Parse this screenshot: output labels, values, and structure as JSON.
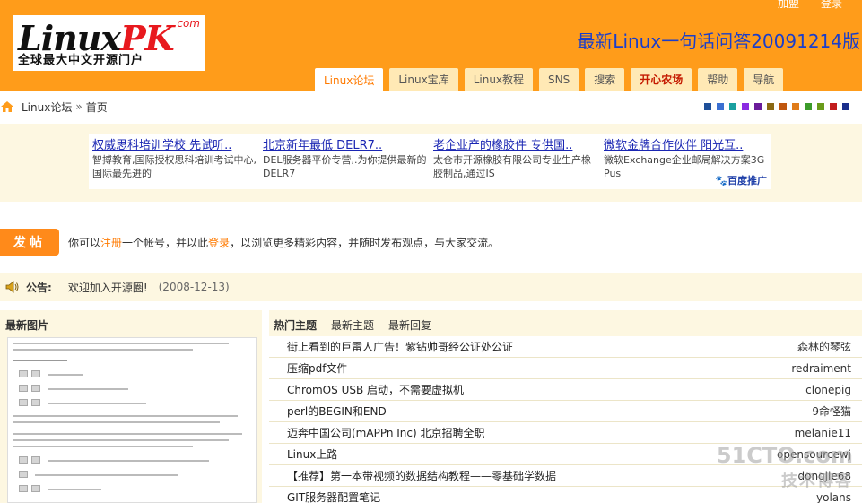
{
  "header": {
    "top_links": [
      "加盟",
      "登录"
    ],
    "logo": {
      "word_a": "Linux",
      "word_b": "PK",
      "com": ".com",
      "slogan": "全球最大中文开源门户"
    },
    "announcement": "最新Linux一句话问答20091214版"
  },
  "nav": [
    "Linux论坛",
    "Linux宝库",
    "Linux教程",
    "SNS",
    "搜索",
    "开心农场",
    "帮助",
    "导航"
  ],
  "breadcrumb": {
    "forum": "Linux论坛",
    "sep": "»",
    "page": "首页"
  },
  "color_swatches": [
    "#1e4f99",
    "#3b6fd1",
    "#1aa0a0",
    "#8a2be2",
    "#6a1b9a",
    "#8b6914",
    "#c0570e",
    "#e07b18",
    "#3c9b2a",
    "#6a9b1a",
    "#c21d1d",
    "#1a2e8c"
  ],
  "ads": [
    {
      "title": "权威思科培训学校 先试听..",
      "desc": "智搏教育,国际授权思科培训考试中心,国际最先进的"
    },
    {
      "title": "北京新年最低 DELR7..",
      "desc": "DEL服务器平价专营,.为你提供最新的DELR7"
    },
    {
      "title": "老企业产的橡胶件 专供国..",
      "desc": "太仓市开源橡胶有限公司专业生产橡胶制品,通过IS"
    },
    {
      "title": "微软金牌合作伙伴 阳光互..",
      "desc": "微软Exchange企业邮局解决方案3G Pus"
    }
  ],
  "baidu": "百度推广",
  "post": {
    "button": "发帖",
    "text_a": "你可以",
    "link_register": "注册",
    "text_b": "一个帐号，并以此",
    "link_login": "登录",
    "text_c": "，以浏览更多精彩内容，并随时发布观点，与大家交流。"
  },
  "notice": {
    "label": "公告:",
    "text": "欢迎加入开源圈!",
    "date": "(2008-12-13)"
  },
  "photos": {
    "title": "最新图片"
  },
  "topics": {
    "tabs": [
      "热门主题",
      "最新主题",
      "最新回复"
    ],
    "rows": [
      {
        "title": "街上看到的巨雷人广告！紫钻帅哥经公证处公证",
        "author": "森林的琴弦"
      },
      {
        "title": "压缩pdf文件",
        "author": "redraiment"
      },
      {
        "title": "ChromOS USB 启动，不需要虚拟机",
        "author": "clonepig"
      },
      {
        "title": "perl的BEGIN和END",
        "author": "9命怪猫"
      },
      {
        "title": "迈奔中国公司(mAPPn Inc) 北京招聘全职",
        "author": "melanie11"
      },
      {
        "title": "Linux上路",
        "author": "opensourcewj"
      },
      {
        "title": "【推荐】第一本带视频的数据结构教程——零基础学数据",
        "author": "dongjie68"
      },
      {
        "title": "GIT服务器配置笔记",
        "author": "yolans"
      }
    ]
  },
  "watermark": {
    "a": "51CTO.com",
    "b": "技术博客"
  }
}
